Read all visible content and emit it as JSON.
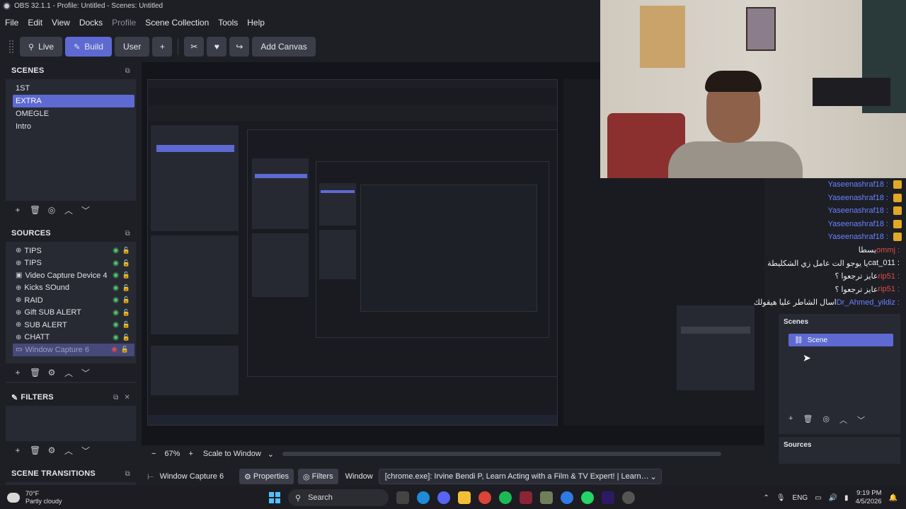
{
  "window": {
    "title": "OBS 32.1.1 - Profile: Untitled - Scenes: Untitled"
  },
  "menu": [
    {
      "label": "File",
      "dim": false
    },
    {
      "label": "Edit",
      "dim": false
    },
    {
      "label": "View",
      "dim": false
    },
    {
      "label": "Docks",
      "dim": false
    },
    {
      "label": "Profile",
      "dim": true
    },
    {
      "label": "Scene Collection",
      "dim": false
    },
    {
      "label": "Tools",
      "dim": false
    },
    {
      "label": "Help",
      "dim": false
    }
  ],
  "toolbar": {
    "live_label": "Live",
    "build_label": "Build",
    "user_label": "User",
    "add_label": "+",
    "add_canvas_label": "Add Canvas"
  },
  "scenes": {
    "title": "SCENES",
    "items": [
      "1ST",
      "EXTRA",
      "OMEGLE",
      "Intro"
    ],
    "selected": "EXTRA"
  },
  "sources": {
    "title": "SOURCES",
    "items": [
      {
        "label": "TIPS"
      },
      {
        "label": "TIPS"
      },
      {
        "label": "Video Capture Device 4"
      },
      {
        "label": "Kicks SOund"
      },
      {
        "label": "RAID"
      },
      {
        "label": "Gift SUB ALERT"
      },
      {
        "label": "SUB ALERT"
      },
      {
        "label": "CHATT"
      },
      {
        "label": "Window Capture 6"
      }
    ]
  },
  "filters": {
    "title": "FILTERS"
  },
  "transitions": {
    "title": "SCENE TRANSITIONS"
  },
  "zoom": {
    "minus": "−",
    "value": "67%",
    "plus": "+",
    "mode": "Scale to Window"
  },
  "context": {
    "source_name": "Window Capture 6",
    "properties_label": "Properties",
    "filters_label": "Filters",
    "window_label": "Window",
    "window_value": "[chrome.exe]: Irvine Bendi P, Learn Acting with a Film & TV Expert! | Learn with acting Tutors - Googl"
  },
  "chat": [
    {
      "user": "Yaseenashraf18 :",
      "msg": "",
      "color": "blue",
      "emoji": true
    },
    {
      "user": "Yaseenashraf18 :",
      "msg": "",
      "color": "blue",
      "emoji": true
    },
    {
      "user": "Yaseenashraf18 :",
      "msg": "",
      "color": "blue",
      "emoji": true
    },
    {
      "user": "Yaseenashraf18 :",
      "msg": "",
      "color": "blue",
      "emoji": true
    },
    {
      "user": "Yaseenashraf18 :",
      "msg": "",
      "color": "blue",
      "emoji": true
    },
    {
      "user": "ommj :",
      "msg": "يسطا",
      "color": "red",
      "emoji": false
    },
    {
      "user": "cat_011 :",
      "msg": "يا يوجو الت عامل زي الشكليطة",
      "color": "white",
      "emoji": false
    },
    {
      "user": "rip51 :",
      "msg": "عايز ترجعوا ؟",
      "color": "red",
      "emoji": false
    },
    {
      "user": "rip51 :",
      "msg": "عايز ترجعوا ؟",
      "color": "red",
      "emoji": false
    },
    {
      "user": "Dr_Ahmed_yildiz :",
      "msg": "اسال الشاطر عليا هيقولك",
      "color": "blue",
      "emoji": false
    }
  ],
  "right_docks": {
    "scenes_title": "Scenes",
    "scene_item": "Scene",
    "sources_title": "Sources"
  },
  "taskbar": {
    "weather_temp": "70°F",
    "weather_desc": "Partly cloudy",
    "search_label": "Search",
    "lang": "ENG",
    "time": "9:19 PM",
    "date": "4/5/2026"
  },
  "colors": {
    "accent": "#5e6ad2",
    "bg": "#1d1f25",
    "panel": "#272a33",
    "eye": "#4ec96c"
  }
}
